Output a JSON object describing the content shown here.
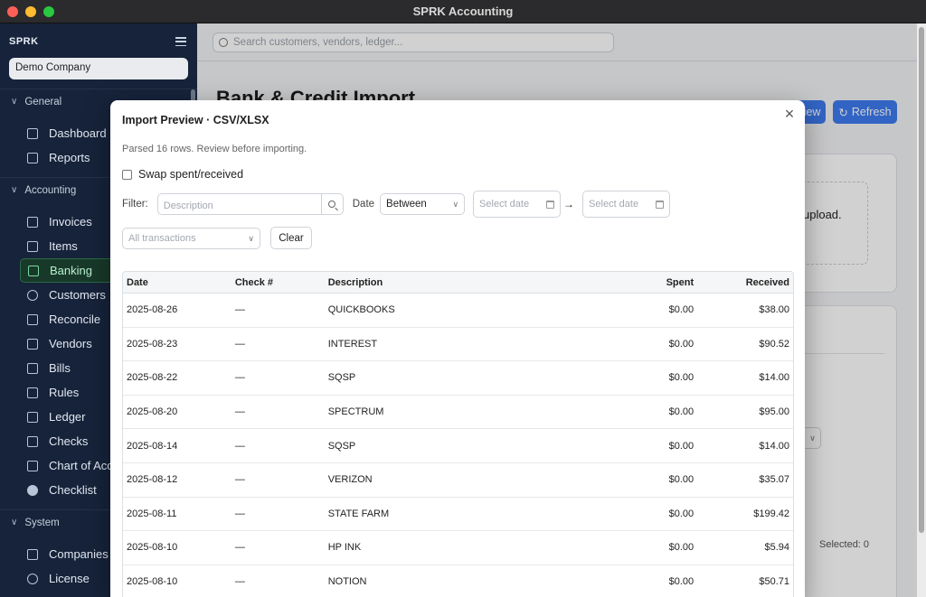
{
  "window": {
    "title": "SPRK Accounting"
  },
  "sidebar": {
    "brand": "SPRK",
    "company": "Demo Company",
    "sections": [
      {
        "label": "General",
        "items": [
          "Dashboard",
          "Reports"
        ]
      },
      {
        "label": "Accounting",
        "items": [
          "Invoices",
          "Items",
          "Banking",
          "Customers",
          "Reconcile",
          "Vendors",
          "Bills",
          "Rules",
          "Ledger",
          "Checks",
          "Chart of Accounts",
          "Checklist"
        ]
      },
      {
        "label": "System",
        "items": [
          "Companies",
          "License"
        ]
      }
    ],
    "active_item": "Banking"
  },
  "main": {
    "search_placeholder": "Search customers, vendors, ledger...",
    "page_title": "Bank & Credit Import",
    "preview_label": "Preview",
    "refresh_label": "Refresh",
    "upload_text": "upload.",
    "selected_text": "Selected: 0"
  },
  "modal": {
    "title": "Import Preview · CSV/XLSX",
    "parsed_text": "Parsed 16 rows. Review before importing.",
    "swap_label": "Swap spent/received",
    "filter_label": "Filter:",
    "description_placeholder": "Description",
    "date_label": "Date",
    "date_mode": "Between",
    "date_from_placeholder": "Select date",
    "date_to_placeholder": "Select date",
    "transactions_placeholder": "All transactions",
    "clear_label": "Clear",
    "columns": [
      "Date",
      "Check #",
      "Description",
      "Spent",
      "Received"
    ],
    "rows": [
      [
        "2025-08-26",
        "—",
        "QUICKBOOKS",
        "$0.00",
        "$38.00"
      ],
      [
        "2025-08-23",
        "—",
        "INTEREST",
        "$0.00",
        "$90.52"
      ],
      [
        "2025-08-22",
        "—",
        "SQSP",
        "$0.00",
        "$14.00"
      ],
      [
        "2025-08-20",
        "—",
        "SPECTRUM",
        "$0.00",
        "$95.00"
      ],
      [
        "2025-08-14",
        "—",
        "SQSP",
        "$0.00",
        "$14.00"
      ],
      [
        "2025-08-12",
        "—",
        "VERIZON",
        "$0.00",
        "$35.07"
      ],
      [
        "2025-08-11",
        "—",
        "STATE FARM",
        "$0.00",
        "$199.42"
      ],
      [
        "2025-08-10",
        "—",
        "HP INK",
        "$0.00",
        "$5.94"
      ],
      [
        "2025-08-10",
        "—",
        "NOTION",
        "$0.00",
        "$50.71"
      ]
    ]
  },
  "colors": {
    "sidebar_bg": "#16233a",
    "accent": "#3d7bf0",
    "active_green": "#2c6b46"
  }
}
